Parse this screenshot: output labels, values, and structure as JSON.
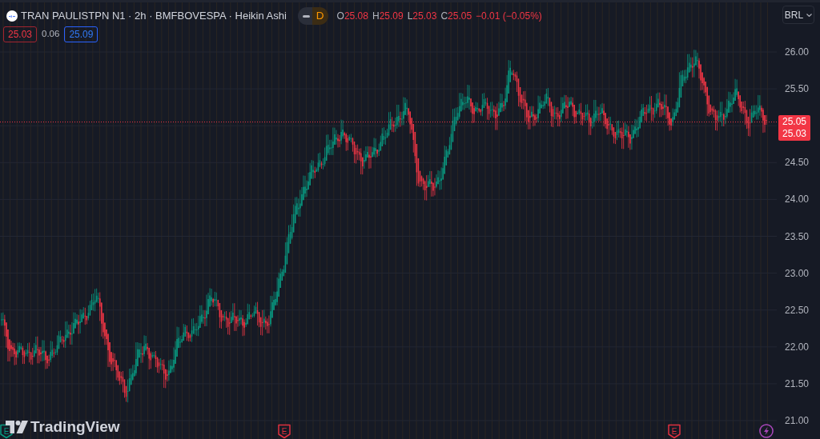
{
  "legend": {
    "title": "TRAN PAULISTPN N1 · 2h · BMFBOVESPA · Heikin Ashi",
    "market_status": "D",
    "ohlc": [
      {
        "label": "O",
        "value": "25.08"
      },
      {
        "label": "H",
        "value": "25.09"
      },
      {
        "label": "L",
        "value": "25.03"
      },
      {
        "label": "C",
        "value": "25.05"
      }
    ],
    "change": "−0.01 (−0.05%)"
  },
  "quote": {
    "bid": "25.03",
    "spread": "0.06",
    "ask": "25.09"
  },
  "currency_button": {
    "label": "BRL"
  },
  "price_axis": {
    "ticks": [
      "26.00",
      "25.50",
      "24.50",
      "24.00",
      "23.50",
      "23.00",
      "22.50",
      "22.00",
      "21.50",
      "21.00"
    ],
    "last_price": "25.05",
    "bid_price": "25.03"
  },
  "events": [
    {
      "kind": "letter",
      "label": "E",
      "color": "#089981"
    },
    {
      "kind": "letter",
      "label": "E",
      "color": "#e0313f"
    },
    {
      "kind": "letter",
      "label": "E",
      "color": "#e0313f"
    },
    {
      "kind": "bolt",
      "color": "#ab47bc"
    }
  ],
  "logo": {
    "text": "TradingView"
  }
}
